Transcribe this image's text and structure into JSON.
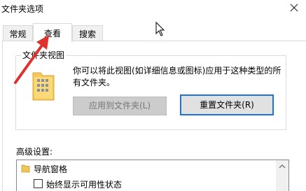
{
  "window": {
    "title": "文件夹选项",
    "close_icon": "close-icon"
  },
  "tabs": [
    {
      "label": "常规",
      "active": false
    },
    {
      "label": "查看",
      "active": true
    },
    {
      "label": "搜索",
      "active": false
    }
  ],
  "folder_views": {
    "group_label": "文件夹视图",
    "description_line1": "你可以将此视图(如详细信息或图标)应用于这种类型的所",
    "description_line2": "有文件夹。",
    "apply_button": "应用到文件夹(L)",
    "reset_button": "重置文件夹(R)",
    "icon": "folder-icon"
  },
  "advanced": {
    "label": "高级设置:",
    "items": [
      {
        "label": "导航窗格",
        "type": "folder",
        "icon": "folder-icon"
      },
      {
        "label": "始终显示可用性状态",
        "type": "checkbox",
        "checked": false
      }
    ]
  },
  "colors": {
    "accent": "#1e74d6",
    "annotation_arrow": "#e0322d"
  }
}
